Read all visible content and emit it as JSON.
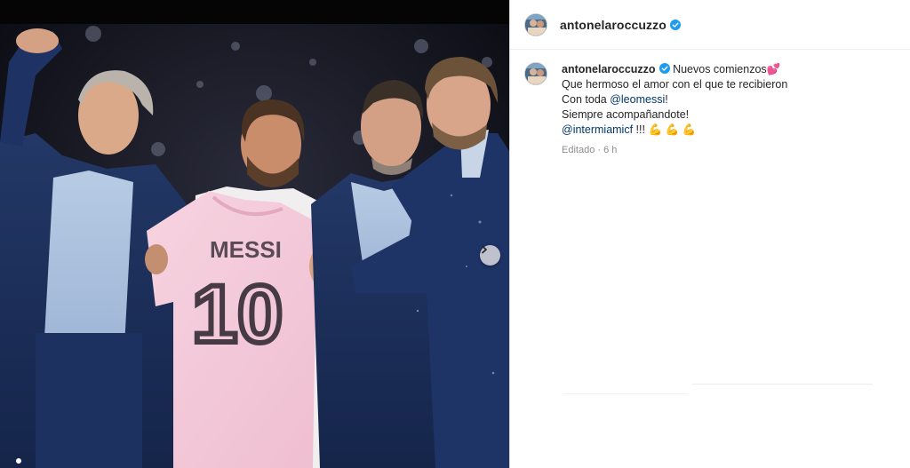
{
  "post": {
    "username": "antonelaroccuzzo",
    "caption": {
      "first_line": "Nuevos comienzos",
      "heart_emoji": "💕",
      "line2": "Que hermoso el amor con el que te recibieron",
      "line3_prefix": "Con toda ",
      "line3_mention": "@leomessi",
      "line3_suffix": "!",
      "line4": "Siempre acompañandote!",
      "line5_mention": "@intermiamicf",
      "line5_suffix": " !!!",
      "flex_emojis": "💪 💪 💪"
    },
    "meta": "Editado · 6 h"
  },
  "photo": {
    "jersey_name": "MESSI",
    "jersey_number": "10"
  },
  "icons": {
    "verified": "verified-badge-icon",
    "next": "chevron-right-icon"
  },
  "colors": {
    "verified": "#1d9bf0",
    "mention": "#00376b",
    "jersey": "#f3c8d8",
    "suit": "#1c2f5a"
  }
}
